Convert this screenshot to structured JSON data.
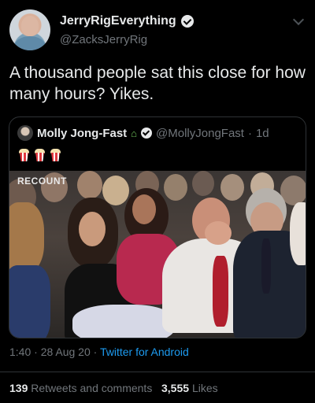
{
  "author": {
    "display_name": "JerryRigEverything",
    "handle": "@ZacksJerryRig",
    "verified": true
  },
  "tweet": {
    "text": "A thousand people sat this close for how many hours? Yikes."
  },
  "quoted_tweet": {
    "display_name": "Molly Jong-Fast",
    "handle": "@MollyJongFast",
    "separator": "·",
    "age": "1d",
    "name_emoji": "house-with-garden-icon",
    "body_emojis": [
      "popcorn-icon",
      "popcorn-icon",
      "popcorn-icon"
    ],
    "media_watermark": "RECOUNT"
  },
  "meta": {
    "timestamp": "1:40 · 28 Aug 20 ·",
    "source": "Twitter for Android"
  },
  "stats": {
    "retweets_count": "139",
    "retweets_label": "Retweets and comments",
    "likes_count": "3,555",
    "likes_label": "Likes"
  },
  "colors": {
    "background": "#000000",
    "primary_text": "#e7e9ea",
    "secondary_text": "#71767b",
    "link": "#1d9bf0",
    "border": "#2f3336"
  }
}
